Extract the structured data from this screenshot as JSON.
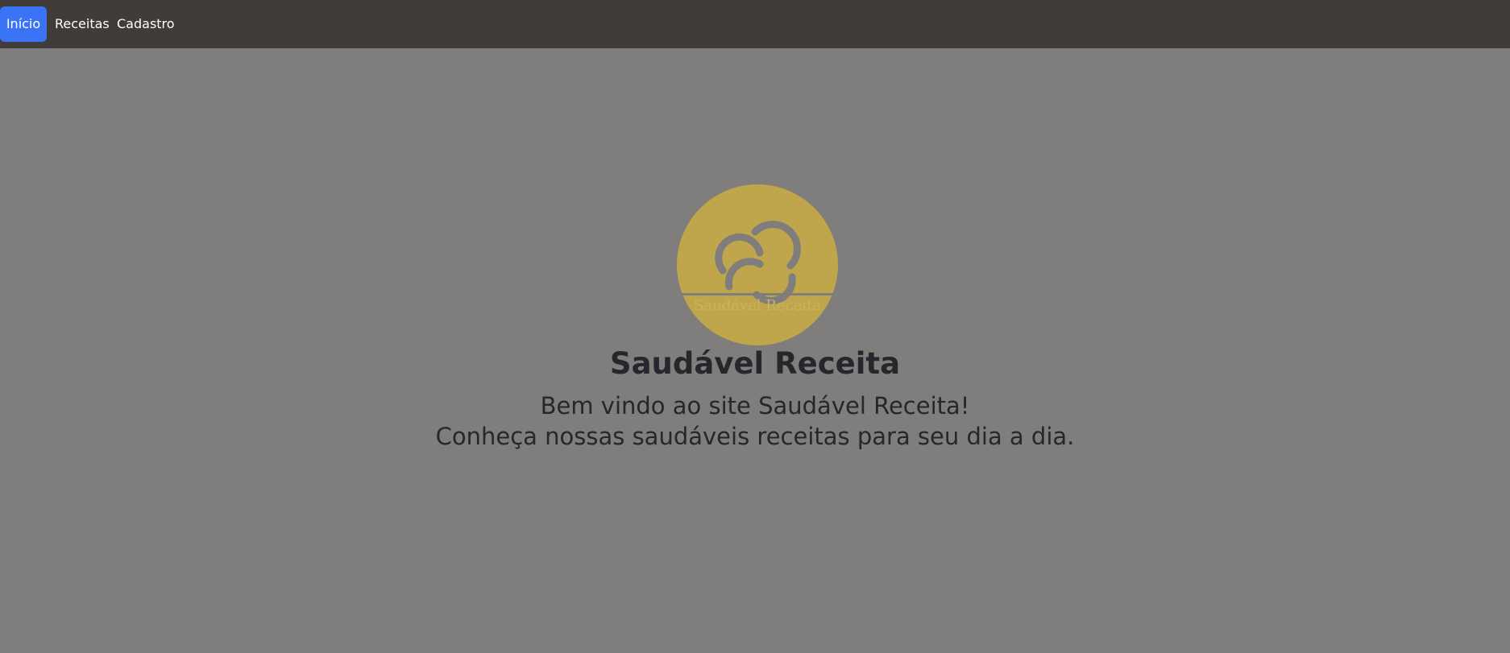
{
  "nav": {
    "items": [
      {
        "label": "Início",
        "active": true
      },
      {
        "label": "Receitas",
        "active": false
      },
      {
        "label": "Cadastro",
        "active": false
      }
    ]
  },
  "hero": {
    "logo_text": "Saudável Receita",
    "title": "Saudável Receita",
    "line1": "Bem vindo ao site Saudável Receita!",
    "line2": "Conheça nossas saudáveis receitas para seu dia a dia."
  },
  "colors": {
    "background": "#7f7e7c",
    "navbar": "#3f3c3a",
    "active_tab": "#3b73f5",
    "logo_gold": "#bfa54b",
    "text": "#24272b"
  }
}
